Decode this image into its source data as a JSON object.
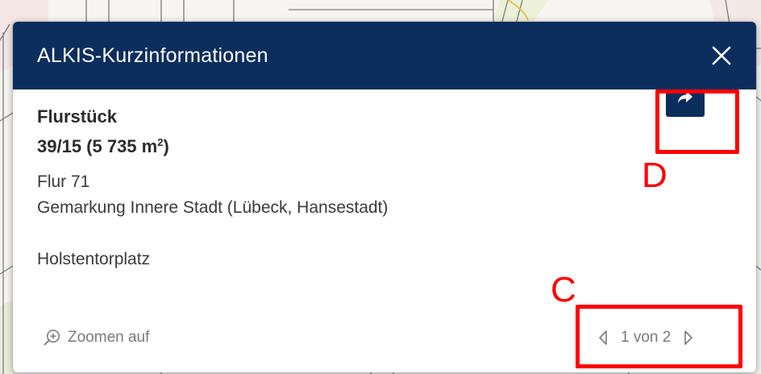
{
  "popup": {
    "title": "ALKIS-Kurzinformationen",
    "close_icon": "close-icon",
    "feature_type": "Flurstück",
    "parcel_number": "39/15 (5 735 m",
    "parcel_unit_sup": "2",
    "parcel_close": ")",
    "flur": "Flur 71",
    "gemarkung": "Gemarkung Innere Stadt (Lübeck, Hansestadt)",
    "address": "Holstentorplatz",
    "action_icon": "share-arrow-icon",
    "zoom_label": "Zoomen auf",
    "zoom_icon": "zoom-in-icon",
    "pager_label": "1 von 2",
    "pager_prev_icon": "triangle-left-icon",
    "pager_next_icon": "triangle-right-icon"
  },
  "annotations": {
    "c_label": "C",
    "d_label": "D",
    "highlight_color": "#ff0000"
  },
  "colors": {
    "header_bg": "#0c2e5d",
    "action_bg": "#0c2e5d"
  }
}
